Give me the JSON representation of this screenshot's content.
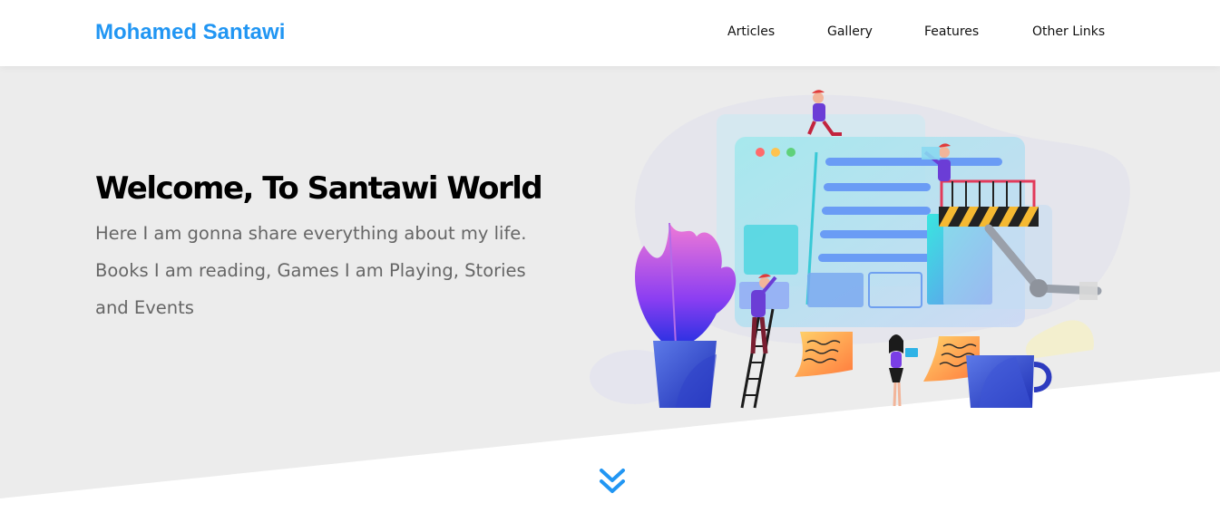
{
  "header": {
    "logo": "Mohamed Santawi",
    "nav": [
      {
        "label": "Articles"
      },
      {
        "label": "Gallery"
      },
      {
        "label": "Features"
      },
      {
        "label": "Other Links"
      }
    ]
  },
  "hero": {
    "title": "Welcome, To Santawi World",
    "description": "Here I am gonna share everything about my life. Books I am reading, Games I am Playing, Stories and Events",
    "illustration_icon": "team-building-website-illustration",
    "scroll_icon": "double-chevron-down-icon"
  },
  "colors": {
    "brand": "#2196f3",
    "hero_background": "#ececec",
    "title": "#000000",
    "text": "#666666"
  }
}
